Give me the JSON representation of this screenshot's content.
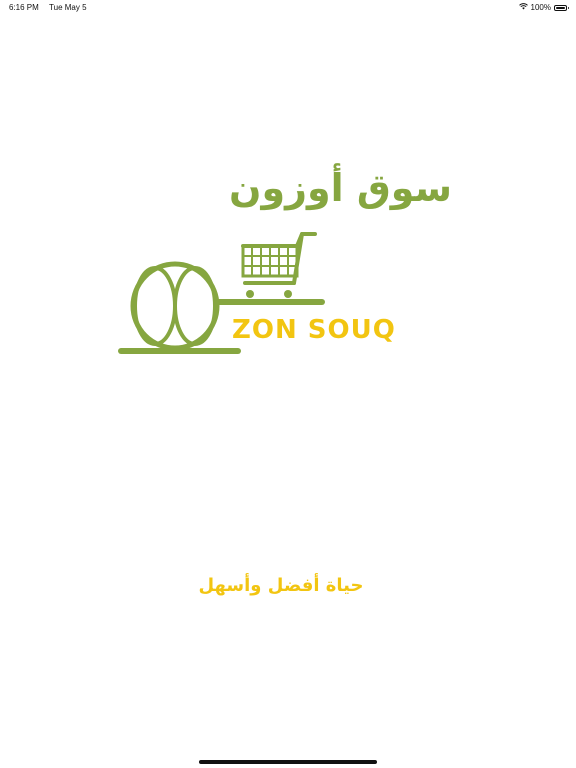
{
  "status_bar": {
    "time": "6:16 PM",
    "date": "Tue May 5",
    "battery_percent": "100%",
    "wifi_icon": "wifi-icon",
    "battery_icon": "battery-icon",
    "battery_level": 1.0
  },
  "logo": {
    "arabic_name": "سوق أوزون",
    "latin_name": "ZON SOUQ",
    "cart_icon": "shopping-cart-icon",
    "o_mark_icon": "o-ring-icon",
    "colors": {
      "green": "#86a640",
      "yellow": "#f2c511"
    }
  },
  "tagline": "حياة أفضل وأسهل"
}
